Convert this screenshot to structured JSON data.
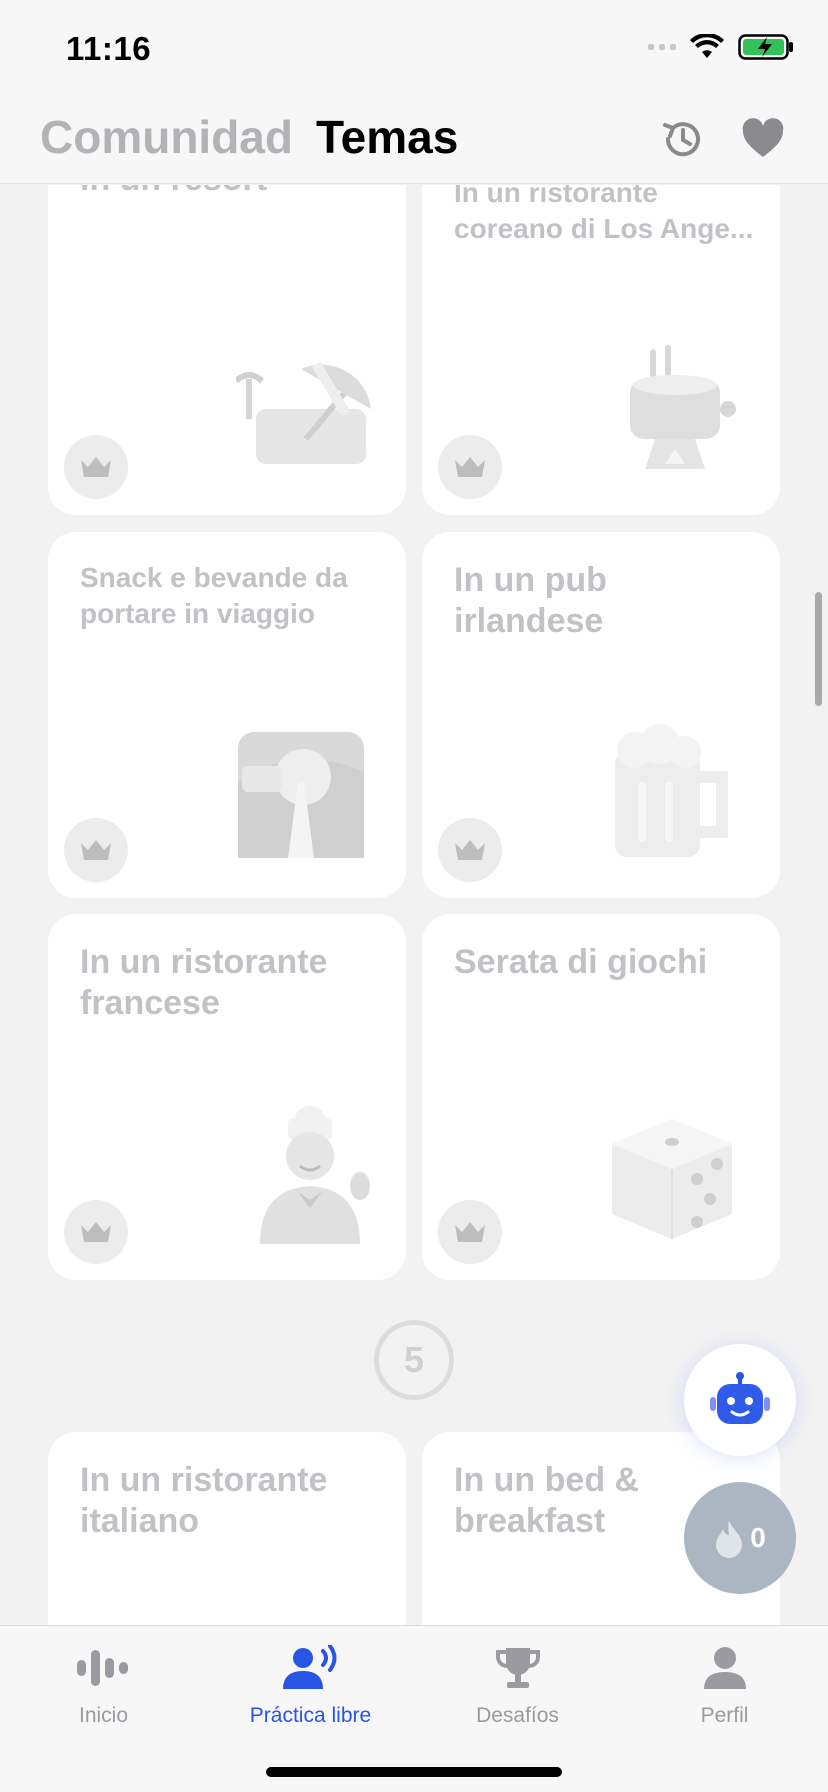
{
  "status_bar": {
    "time": "11:16"
  },
  "header": {
    "tabs": [
      {
        "label": "Comunidad",
        "active": false
      },
      {
        "label": "Temas",
        "active": true
      }
    ],
    "icons": [
      "history-icon",
      "heart-icon"
    ]
  },
  "cards": [
    {
      "title": "In un resort",
      "icon": "beach-umbrella-icon",
      "premium": true
    },
    {
      "title": "In un ristorante coreano di Los Ange...",
      "icon": "hot-pot-icon",
      "premium": true
    },
    {
      "title": "Snack e bevande da portare in viaggio",
      "icon": "road-trip-icon",
      "premium": true
    },
    {
      "title": "In un pub irlandese",
      "icon": "beer-mug-icon",
      "premium": true
    },
    {
      "title": "In un ristorante francese",
      "icon": "chef-icon",
      "premium": true
    },
    {
      "title": "Serata di giochi",
      "icon": "dice-icon",
      "premium": true
    },
    {
      "title": "In un ristorante italiano",
      "icon": "",
      "premium": true
    },
    {
      "title": "In un bed & breakfast",
      "icon": "",
      "premium": true
    }
  ],
  "section": {
    "number": "5"
  },
  "fab": {
    "streak_count": "0"
  },
  "tabbar": {
    "items": [
      {
        "label": "Inicio",
        "icon": "waveform-icon",
        "active": false
      },
      {
        "label": "Práctica libre",
        "icon": "speaking-person-icon",
        "active": true
      },
      {
        "label": "Desafíos",
        "icon": "trophy-icon",
        "active": false
      },
      {
        "label": "Perfil",
        "icon": "person-icon",
        "active": false
      }
    ]
  },
  "colors": {
    "accent": "#2756e6",
    "muted_text": "#c2c2c6",
    "background": "#f2f2f3"
  }
}
